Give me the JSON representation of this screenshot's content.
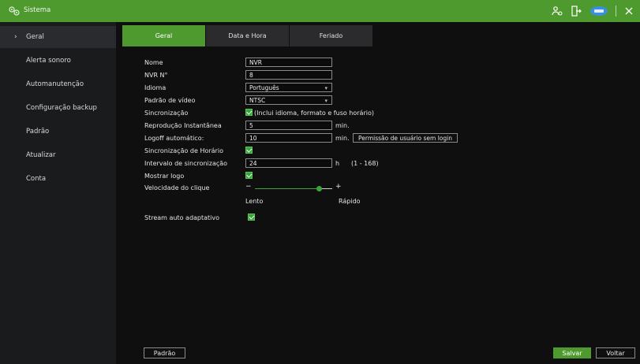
{
  "titlebar": {
    "title": "Sistema",
    "icons": [
      "settings-icon",
      "user-settings-icon",
      "logout-icon",
      "cloud-icon",
      "close-icon"
    ],
    "accent": "#4e9a2f"
  },
  "sidebar": {
    "items": [
      {
        "label": "Geral",
        "active": true
      },
      {
        "label": "Alerta sonoro"
      },
      {
        "label": "Automanutenção"
      },
      {
        "label": "Configuração backup"
      },
      {
        "label": "Padrão"
      },
      {
        "label": "Atualizar"
      },
      {
        "label": "Conta"
      }
    ]
  },
  "tabs": [
    {
      "label": "Geral",
      "active": true
    },
    {
      "label": "Data e Hora"
    },
    {
      "label": "Feriado"
    }
  ],
  "form": {
    "nome": {
      "label": "Nome",
      "value": "NVR"
    },
    "nvr_no": {
      "label": "NVR N°",
      "value": "8"
    },
    "idioma": {
      "label": "Idioma",
      "value": "Português"
    },
    "padrao_video": {
      "label": "Padrão de vídeo",
      "value": "NTSC"
    },
    "sincronizacao": {
      "label": "Sincronização",
      "checked": true,
      "note": "(Inclui idioma, formato e fuso horário)"
    },
    "reproducao": {
      "label": "Reprodução Instantânea",
      "value": "5",
      "unit": "min."
    },
    "logoff": {
      "label": "Logoff automático:",
      "value": "10",
      "unit": "min.",
      "button": "Permissão de usuário sem login"
    },
    "sinc_horario": {
      "label": "Sincronização de Horário",
      "checked": true
    },
    "intervalo": {
      "label": "Intervalo de sincronização",
      "value": "24",
      "unit": "h",
      "range": "(1 - 168)"
    },
    "mostrar_logo": {
      "label": "Mostrar logo",
      "checked": true
    },
    "velocidade": {
      "label": "Velocidade do clique",
      "min_label": "Lento",
      "max_label": "Rápido",
      "minus": "−",
      "plus": "+",
      "level": 0.83
    },
    "stream": {
      "label": "Stream auto adaptativo",
      "checked": true
    }
  },
  "footer": {
    "default_label": "Padrão",
    "save_label": "Salvar",
    "back_label": "Voltar"
  }
}
